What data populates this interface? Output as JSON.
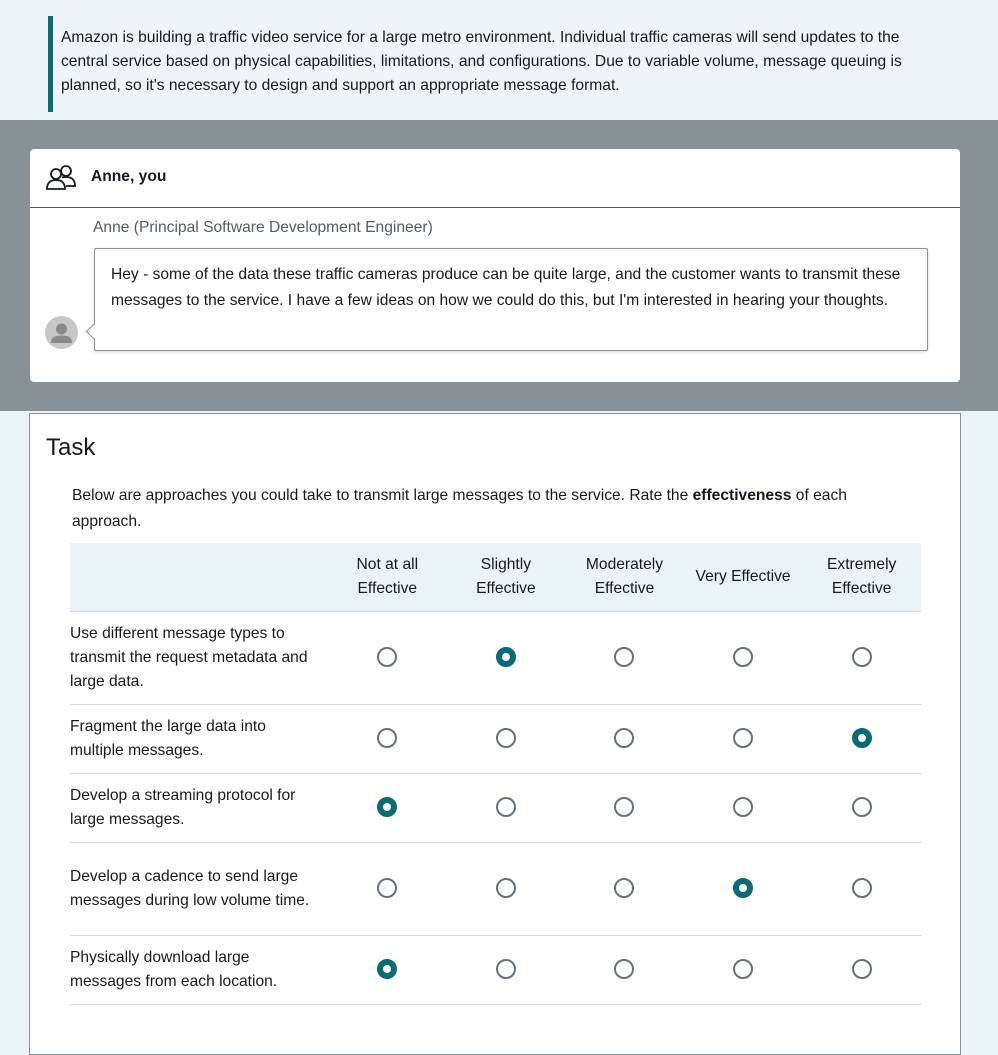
{
  "scenario": {
    "text": "Amazon is building a traffic video service for a large metro environment. Individual traffic cameras will send updates to the central service based on physical capabilities, limitations, and configurations. Due to variable volume, message queuing is planned, so it's necessary to design and support an appropriate message format."
  },
  "chat": {
    "title": "Anne, you",
    "speaker": "Anne (Principal Software Development Engineer)",
    "message": "Hey - some of the data these traffic cameras produce can be quite large, and the customer wants to transmit these messages to the service. I have a few ideas on how we could do this, but I'm interested in hearing your thoughts."
  },
  "task": {
    "heading": "Task",
    "instruction_before": "Below are approaches you could take to transmit large messages to the service. Rate the ",
    "instruction_bold": "effectiveness",
    "instruction_after": " of each approach.",
    "scale": [
      "Not at all Effective",
      "Slightly Effective",
      "Moderately Effective",
      "Very Effective",
      "Extremely Effective"
    ],
    "rows": [
      {
        "statement": "Use different message types to transmit the request metadata and large data.",
        "selected": 1
      },
      {
        "statement": "Fragment the large data into multiple messages.",
        "selected": 4
      },
      {
        "statement": "Develop a streaming protocol for large messages.",
        "selected": 0
      },
      {
        "statement": "Develop a cadence to send large messages during low volume time.",
        "selected": 3
      },
      {
        "statement": "Physically download large messages from each location.",
        "selected": 0
      }
    ]
  },
  "colors": {
    "accent": "#0b6b75",
    "overlay": "#879196",
    "panel_bg": "#eaf3f5"
  }
}
